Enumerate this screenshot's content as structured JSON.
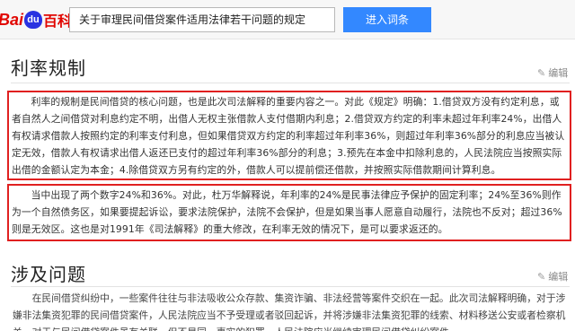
{
  "header": {
    "logo_bai": "Bai",
    "logo_du": "du",
    "logo_baike": "百科",
    "search_value": "关于审理民间借贷案件适用法律若干问题的规定",
    "search_button": "进入词条"
  },
  "sections": {
    "interest": {
      "title": "利率规制",
      "edit_label": "编辑",
      "paragraph1": "利率的规制是民间借贷的核心问题，也是此次司法解释的重要内容之一。对此《规定》明确：1.借贷双方没有约定利息，或者自然人之间借贷对利息约定不明，出借人无权主张借款人支付借期内利息；2.借贷双方约定的利率未超过年利率24%，出借人有权请求借款人按照约定的利率支付利息，但如果借贷双方约定的利率超过年利率36%，则超过年利率36%部分的利息应当被认定无效，借款人有权请求出借人返还已支付的超过年利率36%部分的利息；3.预先在本金中扣除利息的，人民法院应当按照实际出借的金额认定为本金；4.除借贷双方另有约定的外，借款人可以提前偿还借款，并按照实际借款期间计算利息。",
      "paragraph2": "当中出现了两个数字24%和36%。对此，杜万华解释说，年利率的24%是民事法律应予保护的固定利率；24%至36%则作为一个自然债务区，如果要提起诉讼，要求法院保护，法院不会保护，但是如果当事人愿意自动履行，法院也不反对；超过36%则是无效区。这也是对1991年《司法解释》的重大修改，在利率无效的情况下，是可以要求返还的。"
    },
    "issues": {
      "title": "涉及问题",
      "edit_label": "编辑",
      "paragraph": "在民间借贷纠纷中，一些案件往往与非法吸收公众存款、集资诈骗、非法经营等案件交织在一起。此次司法解释明确，对于涉嫌非法集资犯罪的民间借贷案件，人民法院应当不予受理或者驳回起诉，并将涉嫌非法集资犯罪的线索、材料移送公安或者检察机关。对于与民间借贷案件虽有关联，但不是同一事实的犯罪，人民法院应当继续审理民间借贷纠纷案件。"
    }
  }
}
